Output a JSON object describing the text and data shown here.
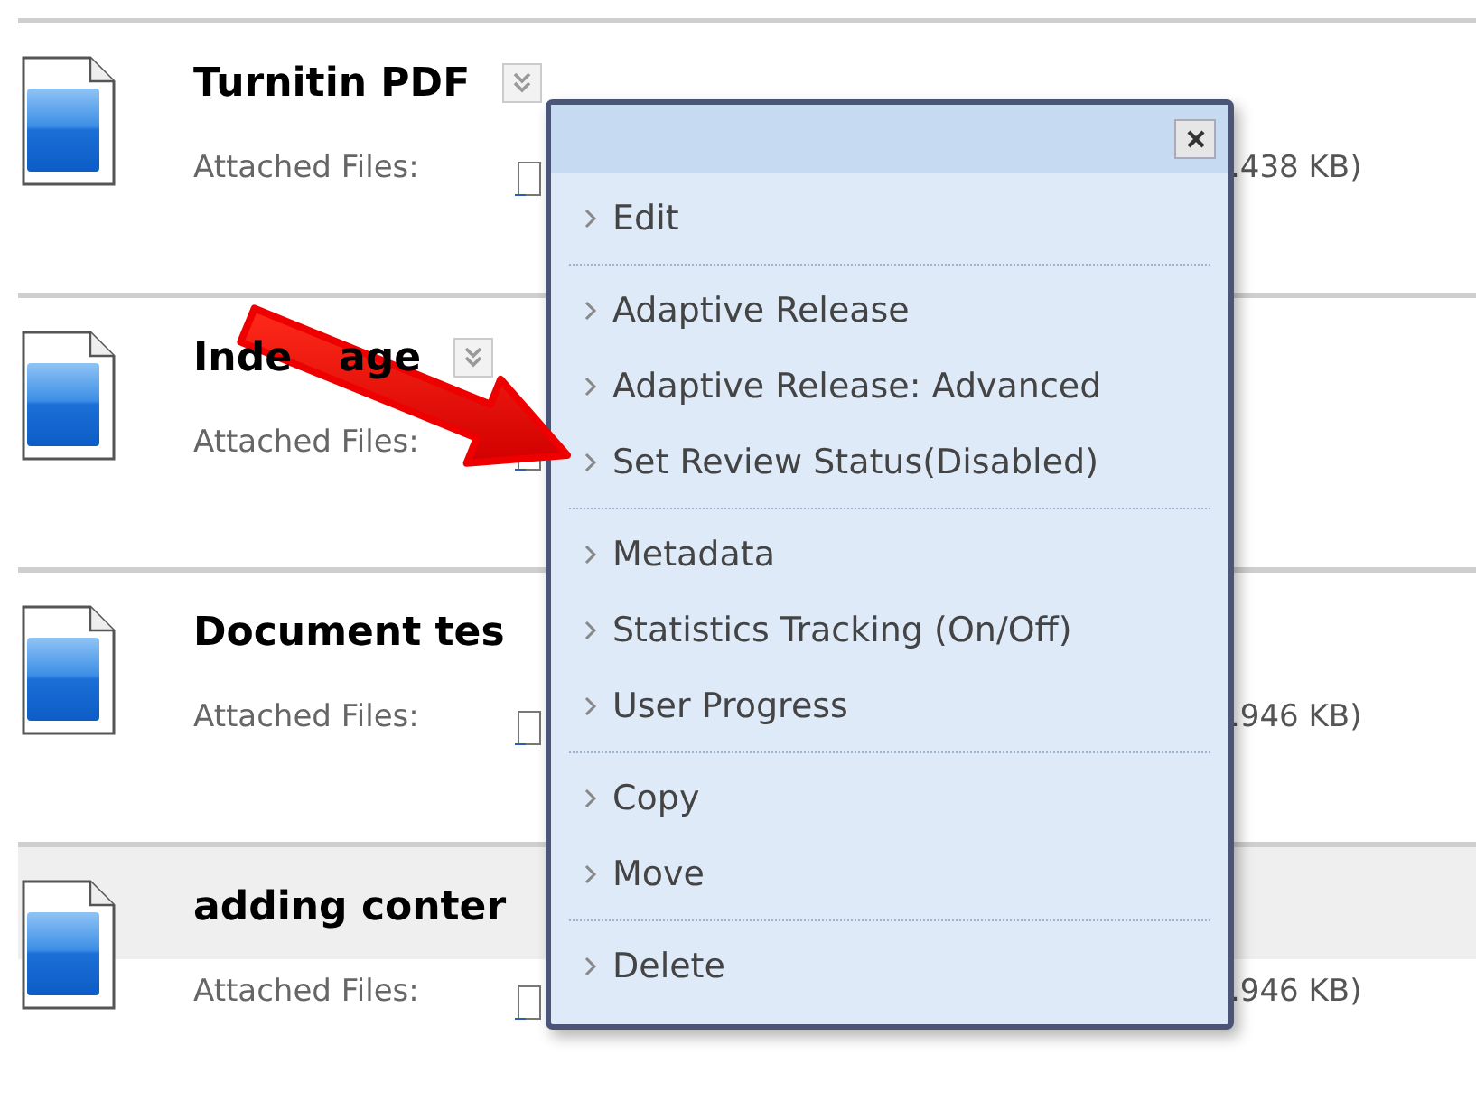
{
  "rows": [
    {
      "title_parts": [
        "Turnitin PDF"
      ],
      "menu_button": true,
      "attached_label": "Attached Files:",
      "size": ".438 KB)",
      "highlighted": false
    },
    {
      "title_parts": [
        "Inde",
        "age"
      ],
      "menu_button": true,
      "attached_label": "Attached Files:",
      "highlighted": false
    },
    {
      "title_parts": [
        "Document tes"
      ],
      "menu_button": false,
      "attached_label": "Attached Files:",
      "size": ".946 KB)",
      "highlighted": false
    },
    {
      "title_parts": [
        "adding conter"
      ],
      "menu_button": false,
      "attached_label": "Attached Files:",
      "size": ".946 KB)",
      "highlighted": true
    }
  ],
  "popup_menu": {
    "groups": [
      [
        "Edit"
      ],
      [
        "Adaptive Release",
        "Adaptive Release: Advanced",
        "Set Review Status(Disabled)"
      ],
      [
        "Metadata",
        "Statistics Tracking (On/Off)",
        "User Progress"
      ],
      [
        "Copy",
        "Move"
      ],
      [
        "Delete"
      ]
    ]
  }
}
